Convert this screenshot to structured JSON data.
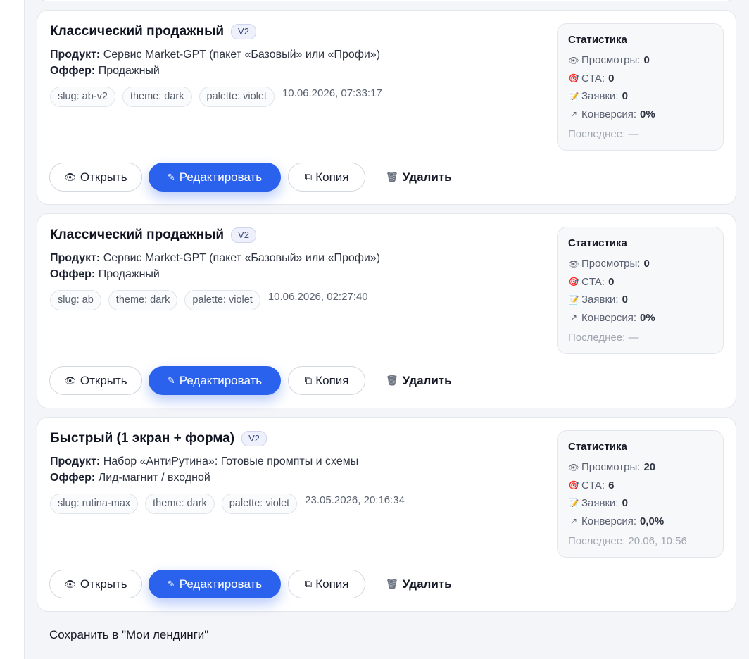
{
  "stats_title": "Статистика",
  "labels": {
    "product": "Продукт:",
    "offer": "Оффер:",
    "views": "Просмотры:",
    "cta": "CTA:",
    "leads": "Заявки:",
    "conversion": "Конверсия:",
    "last": "Последнее:"
  },
  "buttons": {
    "open": "Открыть",
    "edit": "Редактировать",
    "copy": "Копия",
    "delete": "Удалить"
  },
  "icons": {
    "views": "eye-icon",
    "cta": "target-icon",
    "leads": "memo-icon",
    "conversion": "trend-arrow-icon",
    "open": "eye-icon",
    "edit": "pencil-icon",
    "copy": "copy-icon",
    "delete": "trash-icon"
  },
  "accent_color": "#2a62ee",
  "cards": [
    {
      "title": "Классический продажный",
      "version": "V2",
      "product": "Сервис Market-GPT (пакет «Базовый» или «Профи»)",
      "offer": "Продажный",
      "tags": [
        "slug: ab-v2",
        "theme: dark",
        "palette: violet"
      ],
      "date": "10.06.2026, 07:33:17",
      "stats": {
        "views": "0",
        "cta": "0",
        "leads": "0",
        "conversion": "0%",
        "last": "—"
      }
    },
    {
      "title": "Классический продажный",
      "version": "V2",
      "product": "Сервис Market-GPT (пакет «Базовый» или «Профи»)",
      "offer": "Продажный",
      "tags": [
        "slug: ab",
        "theme: dark",
        "palette: violet"
      ],
      "date": "10.06.2026, 02:27:40",
      "stats": {
        "views": "0",
        "cta": "0",
        "leads": "0",
        "conversion": "0%",
        "last": "—"
      }
    },
    {
      "title": "Быстрый (1 экран + форма)",
      "version": "V2",
      "product": "Набор «АнтиРутина»: Готовые промпты и схемы",
      "offer": "Лид-магнит / входной",
      "tags": [
        "slug: rutina-max",
        "theme: dark",
        "palette: violet"
      ],
      "date": "23.05.2026, 20:16:34",
      "stats": {
        "views": "20",
        "cta": "6",
        "leads": "0",
        "conversion": "0,0%",
        "last": "20.06, 10:56"
      }
    }
  ],
  "footer": {
    "save_link": "Сохранить в \"Мои лендинги\""
  }
}
